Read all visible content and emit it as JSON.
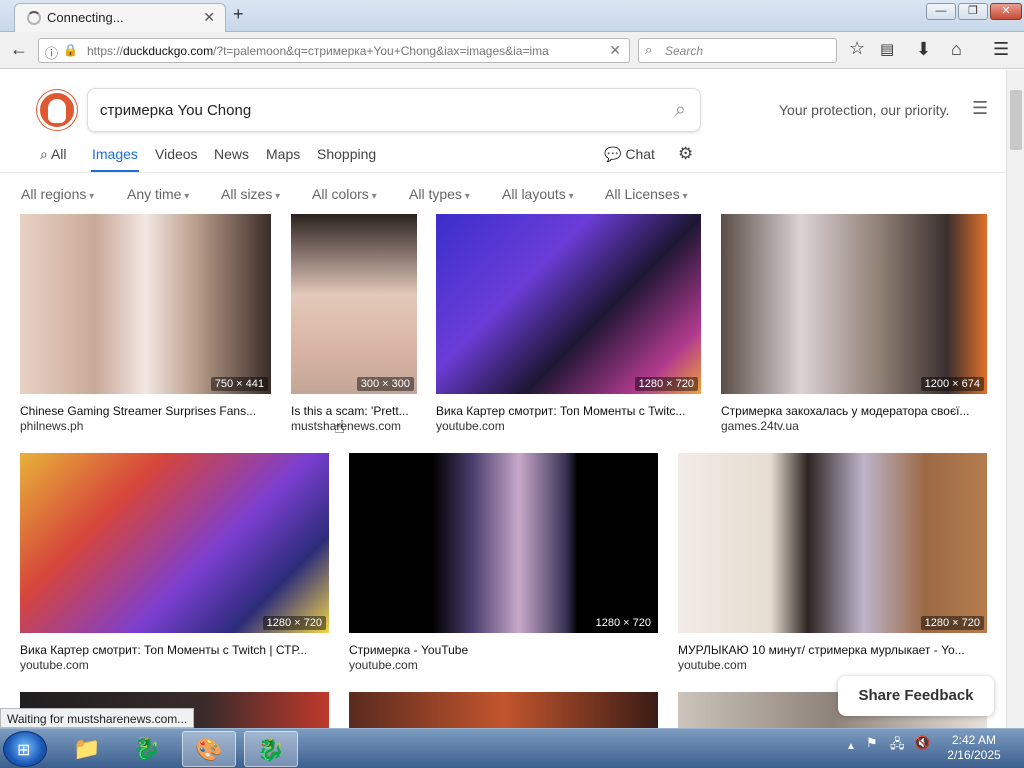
{
  "browser": {
    "tab_title": "Connecting...",
    "url_prefix": "https://",
    "url_domain": "duckduckgo.com",
    "url_rest": "/?t=palemoon&q=стримерка+You+Chong&iax=images&ia=ima",
    "search_placeholder": "Search",
    "status": "Waiting for mustsharenews.com..."
  },
  "ddg": {
    "query": "стримерка You Chong",
    "tagline": "Your protection, our priority.",
    "tabs": {
      "all": "All",
      "images": "Images",
      "videos": "Videos",
      "news": "News",
      "maps": "Maps",
      "shopping": "Shopping",
      "chat": "Chat"
    },
    "filters": [
      "All regions",
      "Any time",
      "All sizes",
      "All colors",
      "All types",
      "All layouts",
      "All Licenses"
    ],
    "feedback": "Share Feedback"
  },
  "results": [
    {
      "title": "Chinese Gaming Streamer Surprises Fans...",
      "source": "philnews.ph",
      "dims": "750 × 441"
    },
    {
      "title": "Is this a scam: 'Prett...",
      "source": "mustsharenews.com",
      "dims": "300 × 300"
    },
    {
      "title": "Вика Картер смотрит: Топ Моменты с Twitc...",
      "source": "youtube.com",
      "dims": "1280 × 720"
    },
    {
      "title": "Стримерка закохалась у модератора своєї...",
      "source": "games.24tv.ua",
      "dims": "1200 × 674"
    },
    {
      "title": "Вика Картер смотрит: Топ Моменты с Twitch | СТР...",
      "source": "youtube.com",
      "dims": "1280 × 720"
    },
    {
      "title": "Стримерка - YouTube",
      "source": "youtube.com",
      "dims": "1280 × 720"
    },
    {
      "title": "МУРЛЫКАЮ 10 минут/ стримерка мурлыкает - Yo...",
      "source": "youtube.com",
      "dims": "1280 × 720"
    }
  ],
  "taskbar": {
    "time": "2:42 AM",
    "date": "2/16/2025"
  },
  "colors": {
    "accent": "#1a6ed8",
    "ddg_orange": "#de5833"
  }
}
